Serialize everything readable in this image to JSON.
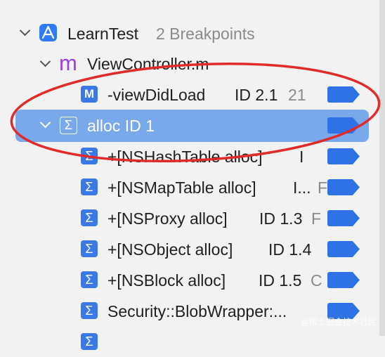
{
  "project": {
    "name": "LearnTest",
    "count": "2 Breakpoints"
  },
  "file": {
    "name": "ViewController.m",
    "icon_letter": "m"
  },
  "row_view_did_load": {
    "badge": "M",
    "label": "-viewDidLoad",
    "id": "ID 2.1",
    "extra": "21"
  },
  "group_alloc": {
    "label": "alloc ID 1"
  },
  "items": [
    {
      "label": "+[NSHashTable alloc]",
      "id": "I"
    },
    {
      "label": "+[NSMapTable alloc]",
      "id": "I...",
      "extra": "F"
    },
    {
      "label": "+[NSProxy alloc]",
      "id": "ID 1.3",
      "extra": "F"
    },
    {
      "label": "+[NSObject alloc]",
      "id": "ID 1.4"
    },
    {
      "label": "+[NSBlock alloc]",
      "id": "ID 1.5",
      "extra": "C"
    },
    {
      "label": "Security::BlobWrapper:..."
    }
  ],
  "watermark": "@稀土掘金技术社区",
  "colors": {
    "selection": "#79a8eb",
    "breakpoint": "#2f72e6",
    "annotation": "#e12b2b"
  },
  "icons": {
    "sigma": "Σ"
  }
}
